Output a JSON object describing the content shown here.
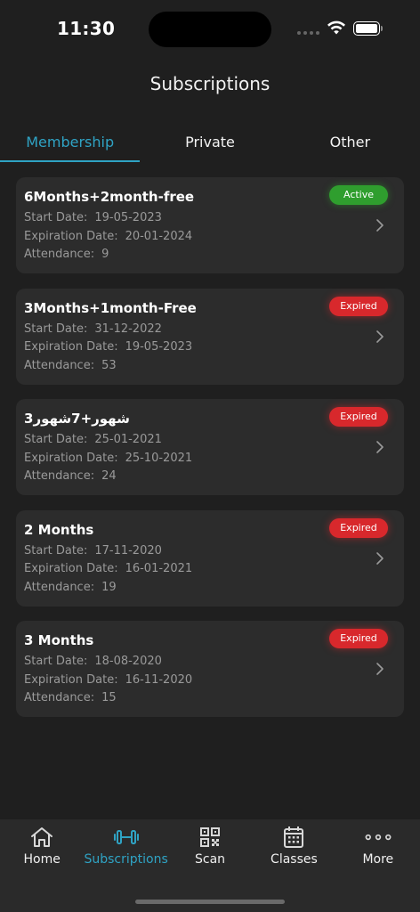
{
  "status_bar": {
    "time": "11:30"
  },
  "header": {
    "title": "Subscriptions"
  },
  "tabs": [
    {
      "label": "Membership",
      "active": true
    },
    {
      "label": "Private",
      "active": false
    },
    {
      "label": "Other",
      "active": false
    }
  ],
  "labels": {
    "start_date": "Start Date:",
    "expiration_date": "Expiration Date:",
    "attendance": "Attendance:"
  },
  "subscriptions": [
    {
      "name": "6Months+2month-free",
      "status": "Active",
      "start_date": "19-05-2023",
      "expiration_date": "20-01-2024",
      "attendance": "9"
    },
    {
      "name": "3Months+1month-Free",
      "status": "Expired",
      "start_date": "31-12-2022",
      "expiration_date": "19-05-2023",
      "attendance": "53"
    },
    {
      "name": "3شهور+7شهور",
      "status": "Expired",
      "start_date": "25-01-2021",
      "expiration_date": "25-10-2021",
      "attendance": "24"
    },
    {
      "name": "2 Months",
      "status": "Expired",
      "start_date": "17-11-2020",
      "expiration_date": "16-01-2021",
      "attendance": "19"
    },
    {
      "name": "3 Months",
      "status": "Expired",
      "start_date": "18-08-2020",
      "expiration_date": "16-11-2020",
      "attendance": "15"
    }
  ],
  "tab_bar": [
    {
      "label": "Home",
      "icon": "home-icon",
      "active": false
    },
    {
      "label": "Subscriptions",
      "icon": "dumbbell-icon",
      "active": true
    },
    {
      "label": "Scan",
      "icon": "qr-code-icon",
      "active": false
    },
    {
      "label": "Classes",
      "icon": "calendar-icon",
      "active": false
    },
    {
      "label": "More",
      "icon": "more-icon",
      "active": false
    }
  ],
  "colors": {
    "accent": "#2fa3c4",
    "background": "#1f1f1f",
    "card": "#2c2c2c",
    "active_badge": "#2f9e2e",
    "expired_badge": "#d8282c"
  }
}
